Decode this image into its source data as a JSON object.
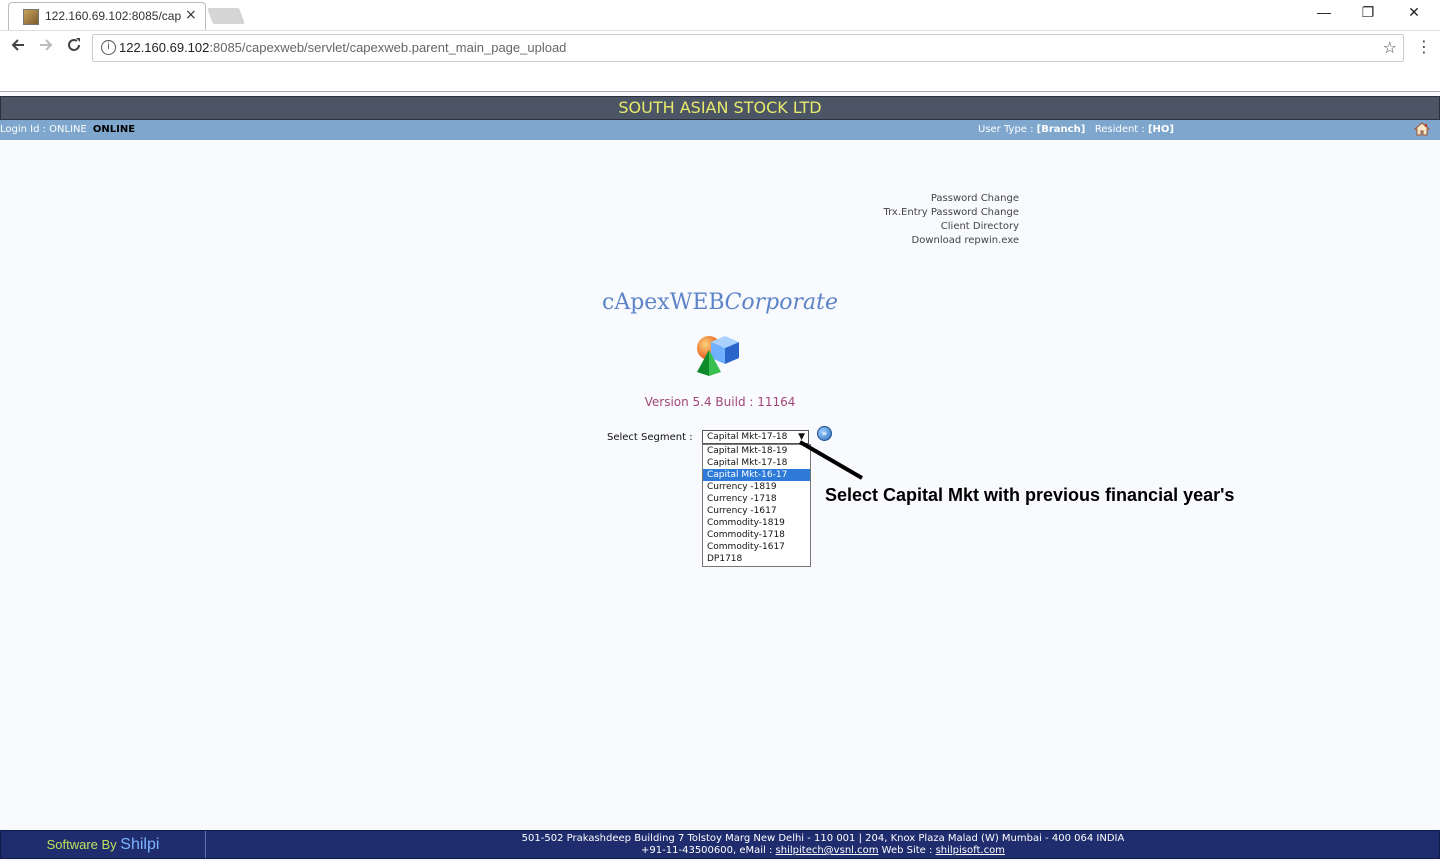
{
  "browser": {
    "tab_title": "122.160.69.102:8085/cap",
    "tab_close": "×",
    "url_host": "122.160.69.102",
    "url_rest": ":8085/capexweb/servlet/capexweb.parent_main_page_upload",
    "minimize": "—",
    "restore": "❐",
    "close": "✕"
  },
  "header": {
    "title": "SOUTH ASIAN STOCK LTD"
  },
  "info_bar": {
    "login_label": "Login Id : ONLINE",
    "login_value": "ONLINE",
    "user_type_label": "User Type : ",
    "user_type_value": "[Branch]",
    "resident_label": "Resident : ",
    "resident_value": "[HO]"
  },
  "links": [
    "Password Change",
    "Trx.Entry Password Change",
    "Client Directory",
    "Download repwin.exe"
  ],
  "brand": {
    "main": "cApexWEB",
    "italic": "Corporate"
  },
  "version": "Version 5.4 Build : 11164",
  "segment": {
    "label": "Select Segment :",
    "selected": "Capital Mkt-17-18",
    "highlighted_index": 2,
    "options": [
      "Capital Mkt-18-19",
      "Capital Mkt-17-18",
      "Capital Mkt-16-17",
      "Currency -1819",
      "Currency -1718",
      "Currency -1617",
      "Commodity-1819",
      "Commodity-1718",
      "Commodity-1617",
      "DP1718"
    ]
  },
  "annotation": "Select Capital Mkt with previous financial year's",
  "footer": {
    "software_by": "Software By ",
    "brand": "Shilpi",
    "line1": "501-502 Prakashdeep Building 7 Tolstoy Marg New Delhi - 110 001  |   204, Knox Plaza Malad (W) Mumbai - 400 064 INDIA",
    "line2_prefix": "+91-11-43500600, eMail : ",
    "email": "shilpitech@vsnl.com",
    "line2_mid": " Web Site : ",
    "website": "shilpisoft.com"
  },
  "colors": {
    "header_bg": "#4c5566",
    "header_text": "#e7ea6a",
    "info_bar": "#7fa7cd",
    "brand": "#5d83c8",
    "version": "#a2477a",
    "footer_bg": "#1f2d6e"
  }
}
